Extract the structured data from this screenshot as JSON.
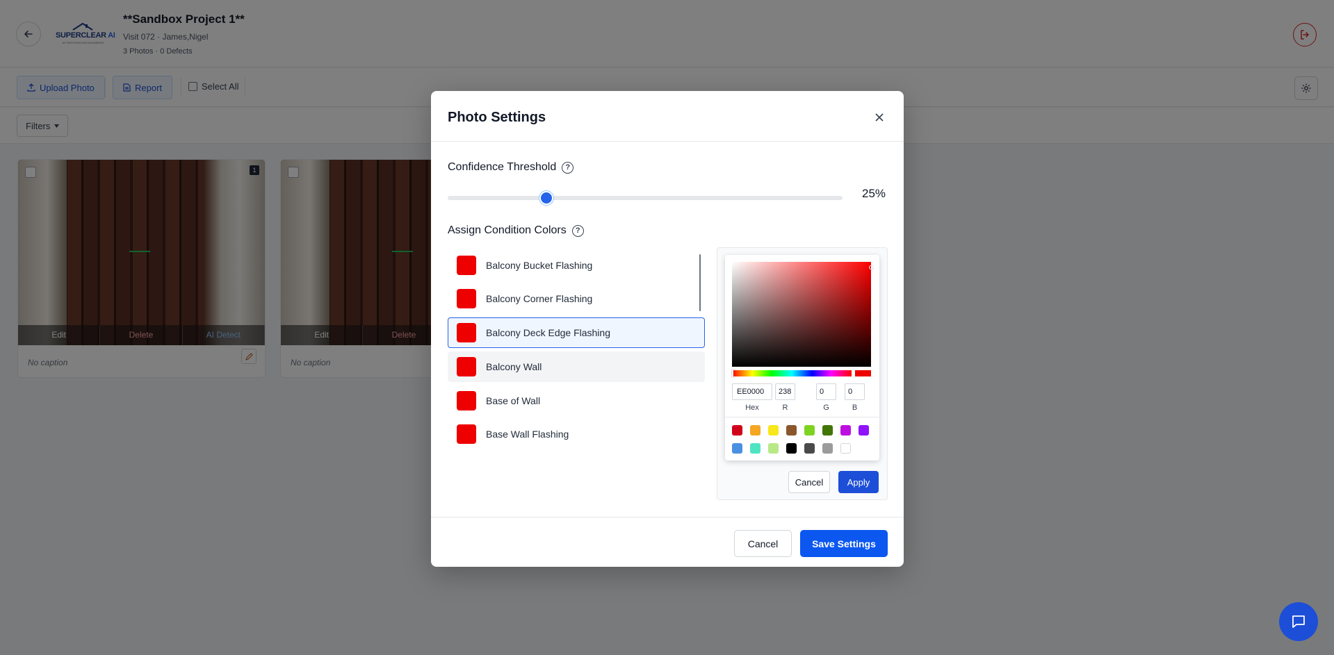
{
  "header": {
    "logo_text": "SUPERCLEAR",
    "logo_ai": " AI",
    "logo_tagline": "BY RESTORATION ENGINEERS",
    "project_title": "**Sandbox Project 1**",
    "visit_info": "Visit 072 · James,Nigel",
    "stats": "3 Photos · 0 Defects"
  },
  "toolbar": {
    "upload_label": "Upload Photo",
    "report_label": "Report",
    "select_all_label": "Select All"
  },
  "filters": {
    "label": "Filters"
  },
  "cards": [
    {
      "number": "1",
      "edit": "Edit",
      "delete": "Delete",
      "ai_detect": "AI Detect",
      "caption": "No caption"
    },
    {
      "edit": "Edit",
      "delete": "Delete",
      "caption": "No caption"
    }
  ],
  "modal": {
    "title": "Photo Settings",
    "confidence_label": "Confidence Threshold",
    "confidence_value": 25,
    "confidence_display": "25%",
    "colors_label": "Assign Condition Colors",
    "help_glyph": "?",
    "conditions": [
      {
        "label": "Balcony Bucket Flashing",
        "color": "#EE0000"
      },
      {
        "label": "Balcony Corner Flashing",
        "color": "#EE0000"
      },
      {
        "label": "Balcony Deck Edge Flashing",
        "color": "#EE0000"
      },
      {
        "label": "Balcony Wall",
        "color": "#EE0000"
      },
      {
        "label": "Base of Wall",
        "color": "#EE0000"
      },
      {
        "label": "Base Wall Flashing",
        "color": "#EE0000"
      }
    ],
    "selected_condition": "Balcony Deck Edge Flashing",
    "picker": {
      "hex": "EE0000",
      "r": "238",
      "g": "0",
      "b": "0",
      "hex_label": "Hex",
      "r_label": "R",
      "g_label": "G",
      "b_label": "B",
      "presets": [
        "#D0021B",
        "#F5A623",
        "#F8E71C",
        "#8B572A",
        "#7ED321",
        "#417505",
        "#BD10E0",
        "#9013FE",
        "#4A90E2",
        "#50E3C2",
        "#B8E986",
        "#000000",
        "#4A4A4A",
        "#9B9B9B",
        "#FFFFFF"
      ],
      "cancel_label": "Cancel",
      "apply_label": "Apply"
    },
    "cancel_label": "Cancel",
    "save_label": "Save Settings"
  },
  "colors": {
    "primary": "#0b57f0",
    "danger": "#dc2626",
    "condition_red": "#EE0000"
  }
}
